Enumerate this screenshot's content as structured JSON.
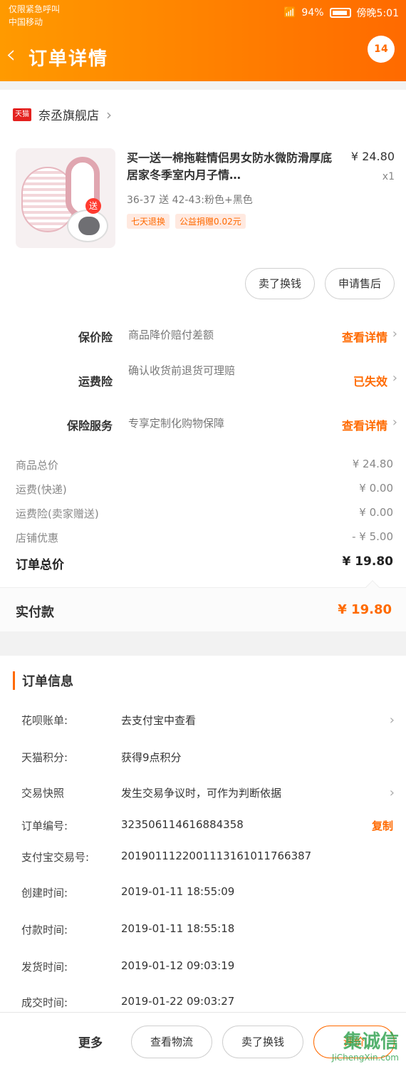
{
  "status_bar": {
    "line1": "仅限紧急呼叫",
    "line2": "中国移动",
    "battery": "94%",
    "time": "傍晚5:01"
  },
  "header": {
    "title": "订单详情",
    "badge": "14"
  },
  "store": {
    "platform": "天猫",
    "name": "奈丞旗舰店"
  },
  "product": {
    "title": "买一送一棉拖鞋情侣男女防水微防滑厚底居家冬季室内月子情…",
    "price": "¥ 24.80",
    "qty": "x1",
    "sku": "36-37 送 42-43:粉色+黑色",
    "gift": "送",
    "tags": [
      "七天退换",
      "公益捐赠0.02元"
    ]
  },
  "actions": {
    "exchange": "卖了换钱",
    "after_sale": "申请售后"
  },
  "insurance": [
    {
      "label": "保价险",
      "desc": "商品降价赔付差额",
      "link": "查看详情"
    },
    {
      "label": "运费险",
      "desc": "确认收货前退货可理赔",
      "link": "已失效"
    },
    {
      "label": "保险服务",
      "desc": "专享定制化购物保障",
      "link": "查看详情"
    }
  ],
  "summary": [
    {
      "k": "商品总价",
      "v": "¥ 24.80"
    },
    {
      "k": "运费(快递)",
      "v": "¥ 0.00"
    },
    {
      "k": "运费险(卖家赠送)",
      "v": "¥ 0.00"
    },
    {
      "k": "店铺优惠",
      "v": "- ¥ 5.00"
    }
  ],
  "total": {
    "k": "订单总价",
    "v": "¥ 19.80"
  },
  "paid": {
    "k": "实付款",
    "v": "¥ 19.80"
  },
  "order_info": {
    "title": "订单信息",
    "rows": [
      {
        "k": "花呗账单:",
        "v": "去支付宝中查看"
      },
      {
        "k": "天猫积分:",
        "v": "获得9点积分"
      },
      {
        "k": "交易快照",
        "v": "发生交易争议时，可作为判断依据"
      },
      {
        "k": "订单编号:",
        "v": "323506114616884358",
        "action": "复制"
      },
      {
        "k": "支付宝交易号:",
        "v": "2019011122001113161011766387"
      },
      {
        "k": "创建时间:",
        "v": "2019-01-11 18:55:09"
      },
      {
        "k": "付款时间:",
        "v": "2019-01-11 18:55:18"
      },
      {
        "k": "发货时间:",
        "v": "2019-01-12 09:03:19"
      },
      {
        "k": "成交时间:",
        "v": "2019-01-22 09:03:27"
      }
    ]
  },
  "bottom_bar": {
    "more": "更多",
    "logistics": "查看物流",
    "sell": "卖了换钱",
    "review": "评价"
  },
  "watermark": {
    "main": "集诚信",
    "sub": "JiChengXin.com"
  }
}
